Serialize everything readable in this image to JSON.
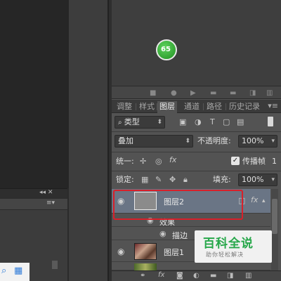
{
  "canvas": {
    "left_panel_controls": "◂◂ ✕",
    "left_panel_menu": "≡▾"
  },
  "badge": {
    "text": "65"
  },
  "tabs": [
    {
      "label": "调整",
      "active": false
    },
    {
      "label": "样式",
      "active": false
    },
    {
      "label": "图层",
      "active": true
    },
    {
      "label": "通道",
      "active": false
    },
    {
      "label": "路径",
      "active": false
    },
    {
      "label": "历史记录",
      "active": false
    }
  ],
  "tabs_menu": "▾≡",
  "filter": {
    "kind_label": "类型",
    "kind_icon": "search-icon"
  },
  "blend": {
    "mode": "叠加",
    "opacity_label": "不透明度:",
    "opacity": "100%"
  },
  "unify": {
    "label": "统一:",
    "propagate_label": "传播帧",
    "propagate_value": "1",
    "fx": "fx"
  },
  "lock": {
    "label": "锁定:",
    "fill_label": "填充:",
    "fill": "100%"
  },
  "layers": [
    {
      "name": "图层2",
      "selected": true,
      "fx": "fx"
    },
    {
      "name": "效果",
      "sub": true
    },
    {
      "name": "描边",
      "sub": true
    },
    {
      "name": "图层1",
      "selected": false
    },
    {
      "name": "",
      "selected": false
    }
  ],
  "bottom_bar": {
    "fx": "fx"
  },
  "watermark": {
    "title": "百科全说",
    "subtitle": "助你轻松解决"
  },
  "colors": {
    "selection_outline": "#d8202a",
    "selected_layer": "#6a7585",
    "watermark_green": "#27a74a"
  }
}
